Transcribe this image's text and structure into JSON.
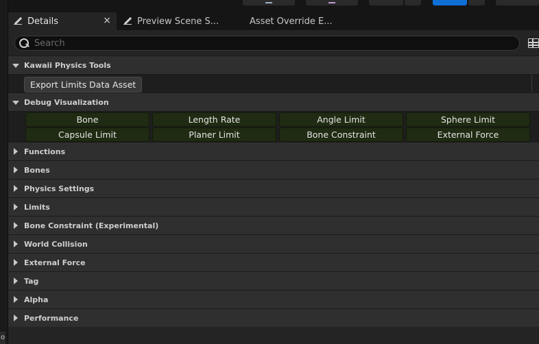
{
  "tabs": {
    "details": "Details",
    "close": "×",
    "preview": "Preview Scene S...",
    "override": "Asset Override E..."
  },
  "search": {
    "placeholder": "Search"
  },
  "kawaii": {
    "title": "Kawaii Physics Tools",
    "export_label": "Export Limits Data Asset"
  },
  "debug": {
    "title": "Debug Visualization",
    "buttons": [
      "Bone",
      "Length Rate",
      "Angle Limit",
      "Sphere Limit",
      "Capsule Limit",
      "Planer Limit",
      "Bone Constraint",
      "External Force"
    ]
  },
  "categories": [
    "Functions",
    "Bones",
    "Physics Settings",
    "Limits",
    "Bone Constraint (Experimental)",
    "World Collision",
    "External Force",
    "Tag",
    "Alpha",
    "Performance"
  ],
  "left_strip": {
    "mini": "o"
  },
  "colors": {
    "accent": "#0f6fd6",
    "debug_button": "#1f2b12",
    "panel": "#242424"
  }
}
